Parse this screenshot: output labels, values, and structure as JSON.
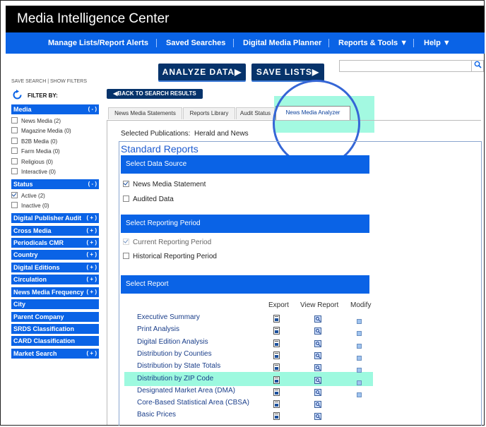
{
  "app": {
    "title": "Media Intelligence Center"
  },
  "nav": {
    "items": [
      {
        "label": "Manage Lists/Report Alerts"
      },
      {
        "label": "Saved Searches"
      },
      {
        "label": "Digital Media Planner"
      },
      {
        "label": "Reports & Tools ▼"
      },
      {
        "label": "Help ▼"
      }
    ]
  },
  "actions": {
    "analyze_label": "ANALYZE DATA▶",
    "save_lists_label": "SAVE LISTS▶"
  },
  "search": {
    "placeholder": "",
    "icon": "search-icon"
  },
  "sidebar": {
    "save_search": "SAVE SEARCH",
    "show_filters": "SHOW FILTERS",
    "filter_by": "FILTER BY:",
    "media": {
      "label": "Media",
      "sign": "( - )",
      "options": [
        {
          "label": "News Media",
          "count": "(2)",
          "checked": false
        },
        {
          "label": "Magazine Media",
          "count": "(0)",
          "checked": false
        },
        {
          "label": "B2B Media",
          "count": "(0)",
          "checked": false
        },
        {
          "label": "Farm Media",
          "count": "(0)",
          "checked": false
        },
        {
          "label": "Religious",
          "count": "(0)",
          "checked": false
        },
        {
          "label": "Interactive",
          "count": "(0)",
          "checked": false
        }
      ]
    },
    "status": {
      "label": "Status",
      "sign": "( - )",
      "options": [
        {
          "label": "Active",
          "count": "(2)",
          "checked": true
        },
        {
          "label": "Inactive",
          "count": "(0)",
          "checked": false
        }
      ]
    },
    "collapsed": [
      {
        "label": "Digital Publisher Audit",
        "sign": "( + )"
      },
      {
        "label": "Cross Media",
        "sign": "( + )"
      },
      {
        "label": "Periodicals CMR",
        "sign": "( + )"
      },
      {
        "label": "Country",
        "sign": "( + )"
      },
      {
        "label": "Digital Editions",
        "sign": "( + )"
      },
      {
        "label": "Circulation",
        "sign": "( + )"
      },
      {
        "label": "News Media Frequency",
        "sign": "( + )"
      },
      {
        "label": "City",
        "sign": ""
      },
      {
        "label": "Parent Company",
        "sign": ""
      },
      {
        "label": "SRDS Classification",
        "sign": ""
      },
      {
        "label": "CARD Classification",
        "sign": ""
      },
      {
        "label": "Market Search",
        "sign": "( + )"
      }
    ]
  },
  "back_button": "◀BACK TO SEARCH RESULTS",
  "tabs": [
    {
      "label": "News Media Statements",
      "active": false
    },
    {
      "label": "Reports Library",
      "active": false
    },
    {
      "label": "Audit Status",
      "active": false
    },
    {
      "label": "News Media Analyzer",
      "active": true
    }
  ],
  "selected_publications": {
    "label": "Selected Publications:",
    "value": "Herald and News"
  },
  "standard_reports": {
    "title": "Standard Reports",
    "data_source": {
      "heading": "Select Data Source",
      "options": [
        {
          "label": "News Media Statement",
          "checked": true
        },
        {
          "label": "Audited Data",
          "checked": false
        }
      ]
    },
    "reporting_period": {
      "heading": "Select Reporting Period",
      "options": [
        {
          "label": "Current Reporting Period",
          "checked": true,
          "disabled": true
        },
        {
          "label": "Historical Reporting Period",
          "checked": false,
          "disabled": false
        }
      ]
    },
    "select_report": {
      "heading": "Select Report",
      "columns": [
        "Export",
        "View Report",
        "Modify"
      ],
      "reports": [
        {
          "name": "Executive Summary",
          "modify": true,
          "highlight": false
        },
        {
          "name": "Print Analysis",
          "modify": true,
          "highlight": false
        },
        {
          "name": "Digital Edition Analysis",
          "modify": true,
          "highlight": false
        },
        {
          "name": "Distribution by Counties",
          "modify": true,
          "highlight": false
        },
        {
          "name": "Distribution by State Totals",
          "modify": true,
          "highlight": false
        },
        {
          "name": "Distribution by ZIP Code",
          "modify": true,
          "highlight": true
        },
        {
          "name": "Designated Market Area (DMA)",
          "modify": true,
          "highlight": false
        },
        {
          "name": "Core-Based Statistical Area (CBSA)",
          "modify": false,
          "highlight": false
        },
        {
          "name": "Basic Prices",
          "modify": false,
          "highlight": false
        }
      ]
    }
  },
  "colors": {
    "nav_blue": "#0a63e6",
    "dark_navy": "#06336b",
    "highlight_teal": "#7cf7d4",
    "circle_blue": "#3566d6"
  }
}
